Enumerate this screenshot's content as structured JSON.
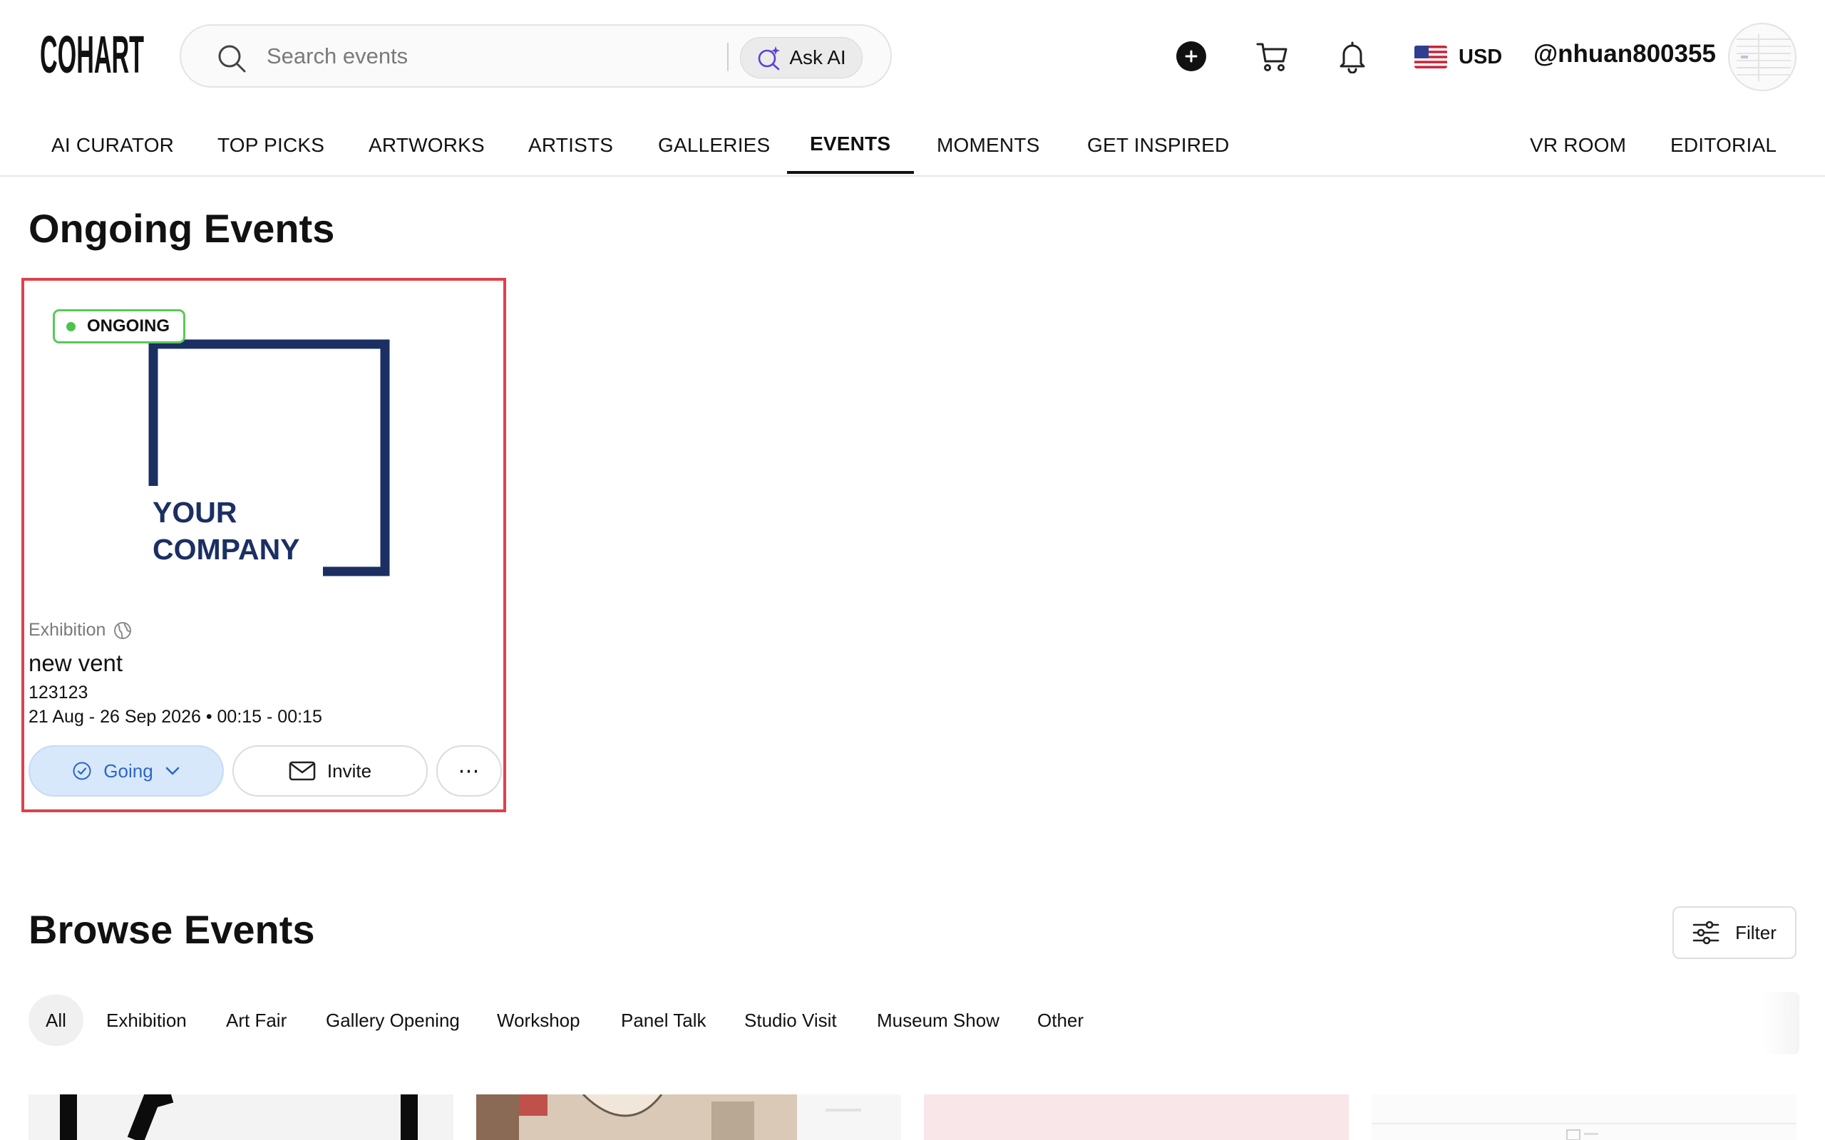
{
  "header": {
    "logo_text": "COHART",
    "search": {
      "placeholder": "Search events",
      "ask_ai_label": "Ask AI"
    },
    "icons": [
      "plus-icon",
      "cart-icon",
      "bell-icon"
    ],
    "currency": {
      "flag": "us-flag",
      "label": "USD"
    },
    "username": "@nhuan800355"
  },
  "nav": {
    "items": [
      {
        "label": "AI CURATOR"
      },
      {
        "label": "TOP PICKS"
      },
      {
        "label": "ARTWORKS"
      },
      {
        "label": "ARTISTS"
      },
      {
        "label": "GALLERIES"
      },
      {
        "label": "EVENTS",
        "active": true
      },
      {
        "label": "MOMENTS"
      },
      {
        "label": "GET INSPIRED"
      },
      {
        "label": "VR ROOM"
      },
      {
        "label": "EDITORIAL"
      }
    ]
  },
  "ongoing": {
    "title": "Ongoing Events",
    "card": {
      "status": "ONGOING",
      "image_text": [
        "YOUR",
        "COMPANY"
      ],
      "type": "Exhibition",
      "title": "new vent",
      "description": "123123",
      "dates": "21 Aug - 26 Sep 2026 • 00:15 - 00:15",
      "going_label": "Going",
      "invite_label": "Invite",
      "more_label": "⋯"
    }
  },
  "browse": {
    "title": "Browse Events",
    "filter_label": "Filter",
    "categories": [
      {
        "label": "All",
        "active": true
      },
      {
        "label": "Exhibition"
      },
      {
        "label": "Art Fair"
      },
      {
        "label": "Gallery Opening"
      },
      {
        "label": "Workshop"
      },
      {
        "label": "Panel Talk"
      },
      {
        "label": "Studio Visit"
      },
      {
        "label": "Museum Show"
      },
      {
        "label": "Other"
      }
    ]
  },
  "colors": {
    "highlight_border": "#e0404c",
    "status_green": "#4cc44c",
    "going_blue": "#2c66c8",
    "company_navy": "#1b2f63"
  }
}
